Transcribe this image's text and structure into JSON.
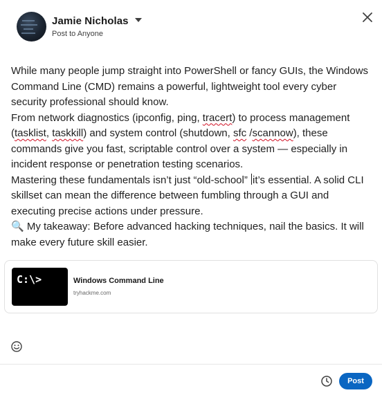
{
  "header": {
    "author_name": "Jamie Nicholas",
    "audience": "Post to Anyone"
  },
  "post": {
    "p1": "While many people jump straight into PowerShell or fancy GUIs, the Windows Command Line (CMD) remains a powerful, lightweight tool every cyber security professional should know.",
    "p2_a": "From network diagnostics (ipconfig, ping, ",
    "p2_tracert": "tracert",
    "p2_b": ") to process management (",
    "p2_tasklist": "tasklist",
    "p2_c": ", ",
    "p2_taskkill": "taskkill",
    "p2_d": ") and system control (shutdown, ",
    "p2_sfc": "sfc",
    "p2_e": " /",
    "p2_scannow": "scannow",
    "p2_f": "), these commands give you fast, scriptable control over a system — especially in incident response or penetration testing scenarios.",
    "p3_a": "Mastering these fundamentals isn’t just “old-school” ",
    "p3_b": "it’s essential. A solid CLI skillset can mean the difference between fumbling through a GUI and executing precise actions under pressure.",
    "p4_icon": "🔍",
    "p4": " My takeaway: Before advanced hacking techniques, nail the basics. It will make every future skill easier."
  },
  "link_card": {
    "thumb_text": "C:\\>",
    "title": "Windows Command Line",
    "domain": "tryhackme.com"
  },
  "footer": {
    "post_label": "Post"
  },
  "icons": {
    "caret": "chevron-down-icon",
    "close": "close-icon",
    "emoji": "emoji-icon",
    "schedule": "clock-icon"
  },
  "colors": {
    "accent": "#0a66c2",
    "spellcheck": "#d11124"
  }
}
